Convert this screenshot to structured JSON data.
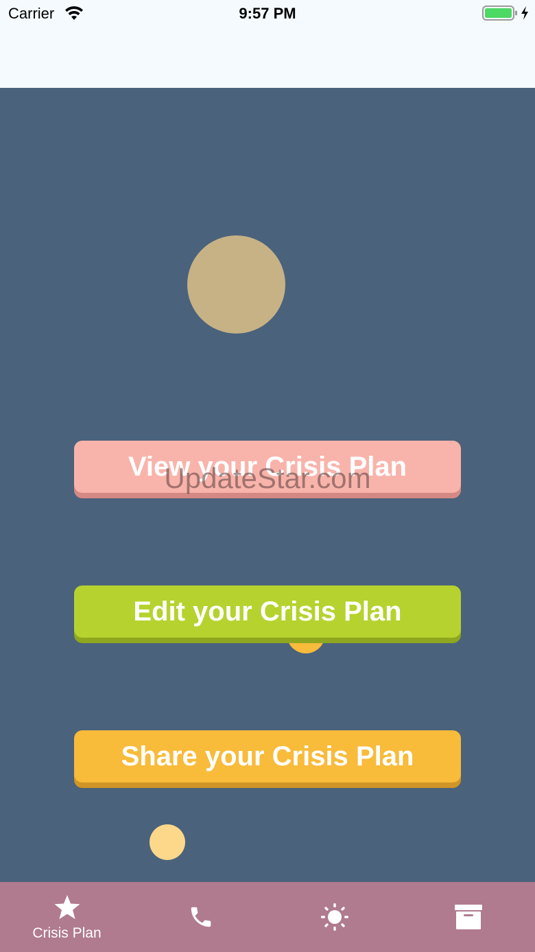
{
  "status_bar": {
    "carrier": "Carrier",
    "time": "9:57 PM",
    "wifi_icon": "wifi-icon",
    "battery_icon": "battery-icon",
    "charging_icon": "charging-bolt-icon"
  },
  "colors": {
    "background": "#4a627c",
    "header": "#f5fafe",
    "tab_bar": "#b07a8f",
    "view_button": "#f8b4ab",
    "edit_button": "#b6d22e",
    "share_button": "#f8bb3a"
  },
  "main": {
    "buttons": {
      "view": "View your Crisis Plan",
      "edit": "Edit your Crisis Plan",
      "share": "Share your Crisis Plan"
    },
    "watermark": "UpdateStar.com"
  },
  "tab_bar": {
    "tabs": [
      {
        "icon": "star-icon",
        "label": "Crisis Plan"
      },
      {
        "icon": "phone-icon",
        "label": ""
      },
      {
        "icon": "sun-icon",
        "label": ""
      },
      {
        "icon": "archive-box-icon",
        "label": ""
      }
    ]
  }
}
